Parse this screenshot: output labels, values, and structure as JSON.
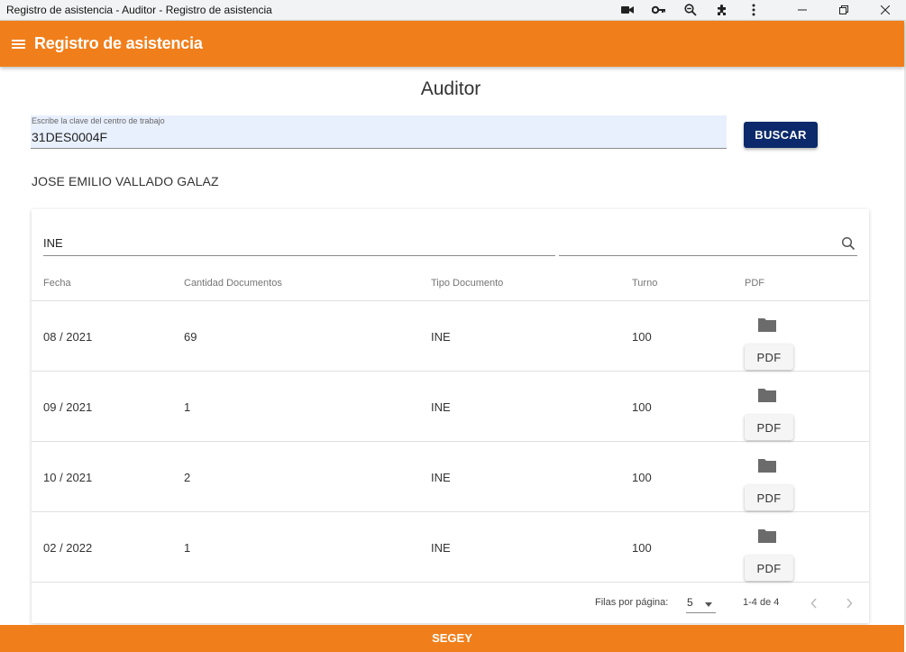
{
  "window": {
    "title": "Registro de asistencia - Auditor - Registro de asistencia",
    "toolbar_icons": [
      "camera-icon",
      "key-icon",
      "zoom-out-icon",
      "extensions-icon",
      "more-vert-icon"
    ],
    "window_controls": [
      "minimize-icon",
      "restore-icon",
      "close-icon"
    ]
  },
  "appbar": {
    "menu_icon": "hamburger-menu-icon",
    "title": "Registro de asistencia",
    "color": "#f07f1b"
  },
  "main": {
    "heading": "Auditor",
    "clave": {
      "label": "Escribe la clave del centro de trabajo",
      "value": "31DES0004F"
    },
    "search_button": "BUSCAR",
    "search_button_color": "#0c2a6b",
    "person_name": "JOSE EMILIO VALLADO GALAZ"
  },
  "table": {
    "filter_type_value": "INE",
    "search_value": "",
    "search_icon": "search-icon",
    "columns": [
      "Fecha",
      "Cantidad Documentos",
      "Tipo Documento",
      "Turno",
      "PDF"
    ],
    "rows": [
      {
        "fecha": "08 / 2021",
        "cantidad": "69",
        "tipo": "INE",
        "turno": "100",
        "pdf_label": "PDF",
        "icon": "folder-icon"
      },
      {
        "fecha": "09 / 2021",
        "cantidad": "1",
        "tipo": "INE",
        "turno": "100",
        "pdf_label": "PDF",
        "icon": "folder-icon"
      },
      {
        "fecha": "10 / 2021",
        "cantidad": "2",
        "tipo": "INE",
        "turno": "100",
        "pdf_label": "PDF",
        "icon": "folder-icon"
      },
      {
        "fecha": "02 / 2022",
        "cantidad": "1",
        "tipo": "INE",
        "turno": "100",
        "pdf_label": "PDF",
        "icon": "folder-icon"
      }
    ],
    "pagination": {
      "rows_label": "Filas por página:",
      "rows_per_page": "5",
      "range": "1-4 de 4",
      "prev_icon": "chevron-left-icon",
      "next_icon": "chevron-right-icon"
    }
  },
  "footer": {
    "text": "SEGEY"
  }
}
